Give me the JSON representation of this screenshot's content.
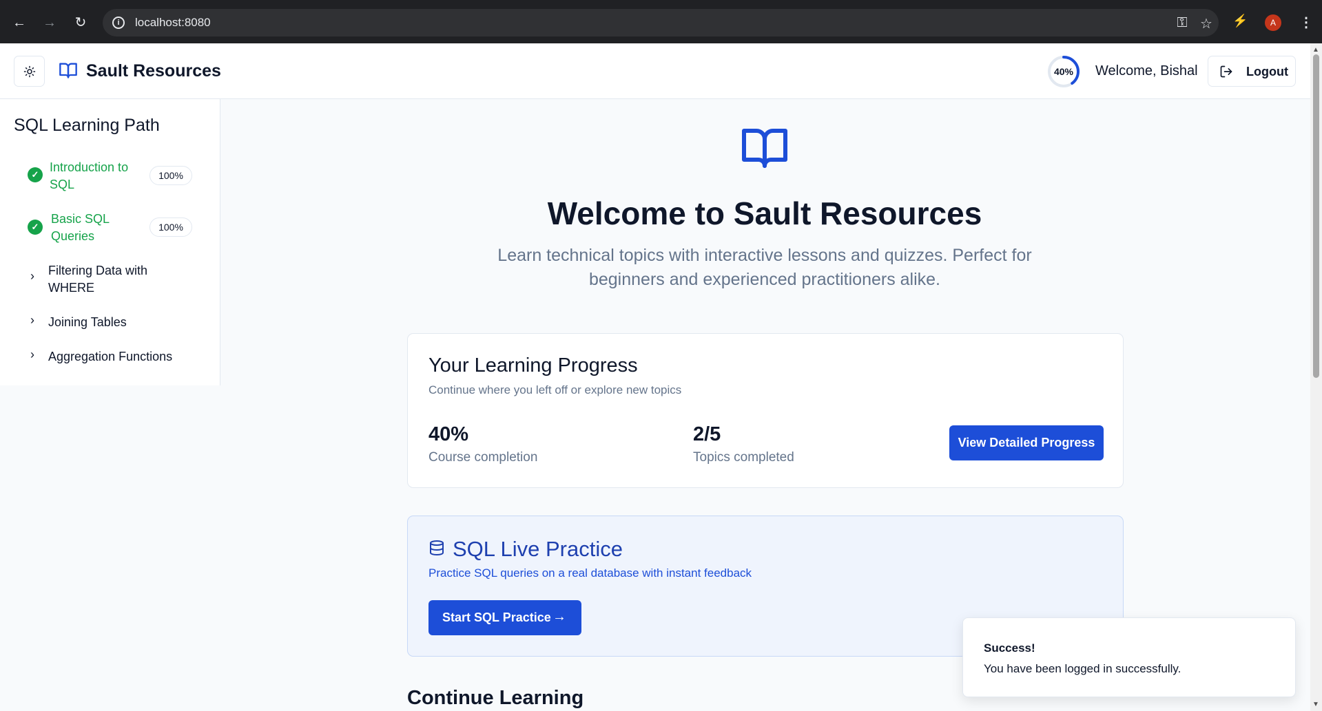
{
  "browser": {
    "url": "localhost:8080",
    "profile_initial": "A"
  },
  "header": {
    "brand": "Sault Resources",
    "progress_label": "40%",
    "progress_value": 0.4,
    "welcome": "Welcome, Bishal",
    "logout_label": "Logout",
    "accent": "#1d4ed8"
  },
  "sidebar": {
    "title": "SQL Learning Path",
    "topics": [
      {
        "label": "Introduction to SQL",
        "badge": "100%",
        "status": "complete"
      },
      {
        "label": "Basic SQL Queries",
        "badge": "100%",
        "status": "complete"
      },
      {
        "label": "Filtering Data with WHERE",
        "status": "incomplete"
      },
      {
        "label": "Joining Tables",
        "status": "incomplete"
      },
      {
        "label": "Aggregation Functions",
        "status": "incomplete"
      }
    ],
    "complete_color": "#16a34a"
  },
  "hero": {
    "title": "Welcome to Sault Resources",
    "subtitle": "Learn technical topics with interactive lessons and quizzes. Perfect for beginners and experienced practitioners alike."
  },
  "progress_card": {
    "title": "Your Learning Progress",
    "subtitle": "Continue where you left off or explore new topics",
    "stats": [
      {
        "value": "40%",
        "label": "Course completion"
      },
      {
        "value": "2/5",
        "label": "Topics completed"
      }
    ],
    "button": "View Detailed Progress"
  },
  "practice_card": {
    "title": "SQL Live Practice",
    "subtitle": "Practice SQL queries on a real database with instant feedback",
    "button": "Start SQL Practice"
  },
  "continue_heading": "Continue Learning",
  "toast": {
    "title": "Success!",
    "message": "You have been logged in successfully."
  }
}
